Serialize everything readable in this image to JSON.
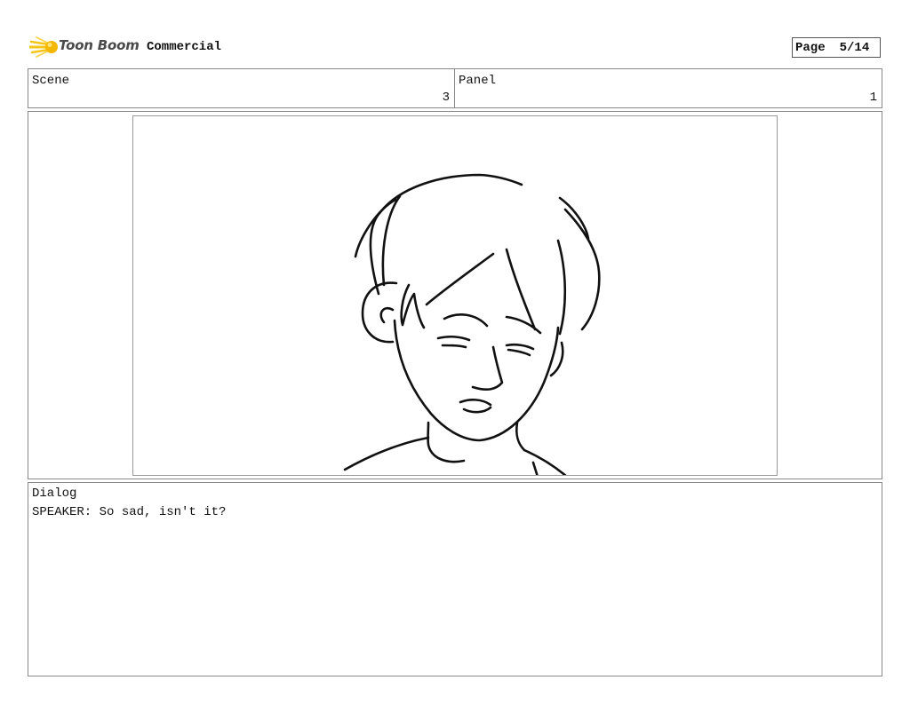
{
  "header": {
    "logo_text": "Toon Boom",
    "project_title": "Commercial",
    "page_label": "Page",
    "page_value": "5/14"
  },
  "scene": {
    "label": "Scene",
    "value": "3"
  },
  "panel": {
    "label": "Panel",
    "value": "1"
  },
  "dialog": {
    "label": "Dialog",
    "text": "SPEAKER: So sad, isn't it?"
  },
  "colors": {
    "logo_accent": "#f5c518",
    "ink": "#111111",
    "border": "#888888"
  },
  "icons": {
    "logo": "toon-boom-logo-icon"
  }
}
